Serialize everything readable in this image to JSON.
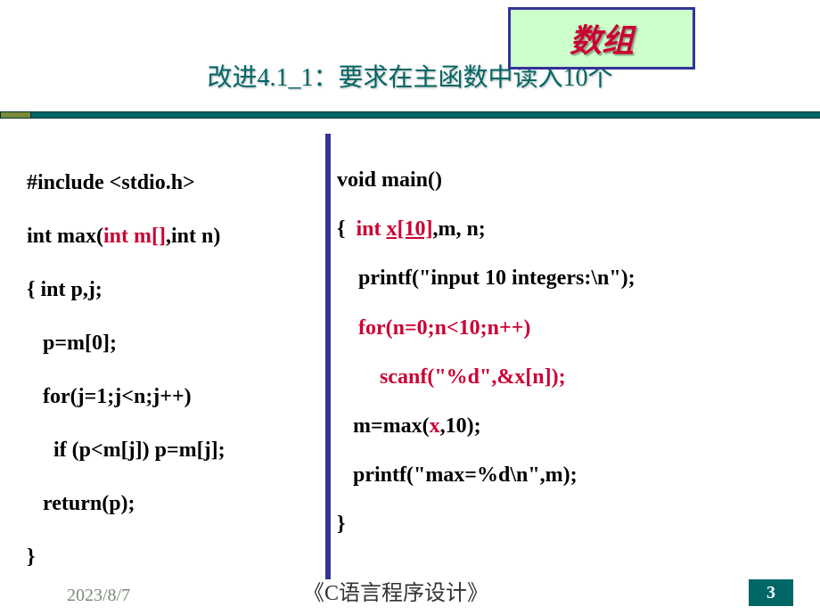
{
  "title": "改进4.1_1：要求在主函数中读入10个",
  "callout": "数组",
  "code_left": {
    "l1": "#include <stdio.h>",
    "l2_a": "int max(",
    "l2_b": "int m[]",
    "l2_c": ",int n)",
    "l3": "{ int p,j;",
    "l4": "   p=m[0];",
    "l5": "   for(j=1;j<n;j++)",
    "l6": "     if (p<m[j]) p=m[j];",
    "l7": "   return(p);",
    "l8": "}"
  },
  "code_right": {
    "l1": "void main()",
    "l2_a": "{  ",
    "l2_b": "int ",
    "l2_c": "x[10]",
    "l2_d": ",m, n;",
    "l3": "    printf(\"input 10 integers:\\n\");",
    "l4": "    for(n=0;n<10;n++)",
    "l5": "        scanf(\"%d\",&x[n]);",
    "l6_a": "   m=max(",
    "l6_b": "x",
    "l6_c": ",10);",
    "l7": "   printf(\"max=%d\\n\",m);",
    "l8": "}"
  },
  "footer": {
    "date": "2023/8/7",
    "book": "《C语言程序设计》",
    "page": "3"
  }
}
